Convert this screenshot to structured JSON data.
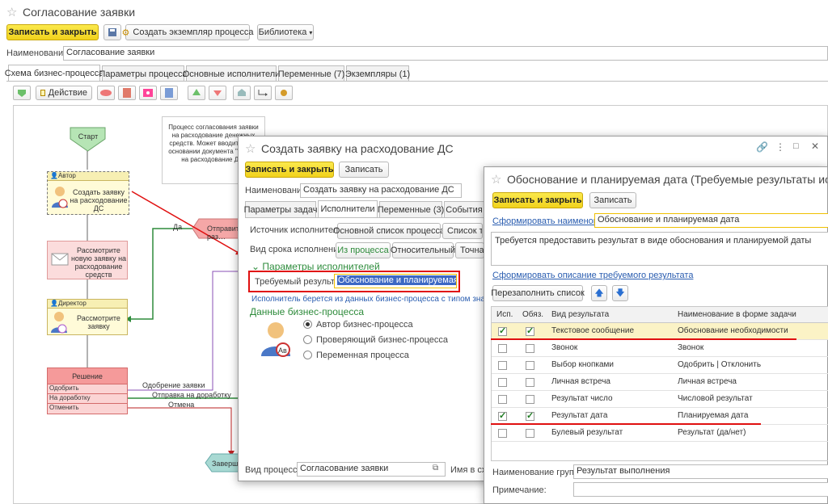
{
  "main": {
    "title": "Согласование заявки",
    "toolbar": {
      "save_close": "Записать и закрыть",
      "create_instance": "Создать экземпляр процесса",
      "library": "Библиотека"
    },
    "name_label": "Наименование:",
    "name_value": "Согласование заявки",
    "tabs": [
      "Схема бизнес-процесса",
      "Параметры процесса",
      "Основные исполнители",
      "Переменные (7)",
      "Экземпляры (1)"
    ],
    "action_label": "Действие"
  },
  "diagram": {
    "start": "Старт",
    "note": "Процесс согласования заявки на расходование денежных средств. Может вводиться на основании документа \"Заявка на расходование ДС\"",
    "author_head": "Автор",
    "author_task": "Создать заявку на расходование ДС",
    "review_task": "Рассмотрите новую заявку на расходование средств",
    "director_head": "Директор",
    "director_task": "Рассмотрите заявку",
    "decision_head": "Решение",
    "decision_items": [
      "Одобрить",
      "На доработку",
      "Отменить"
    ],
    "edge_yes": "Да",
    "edge_approve": "Одобрение заявки",
    "edge_rework": "Отправка на доработку",
    "edge_cancel": "Отмена",
    "send_node": "Отправит… раз…",
    "finish_node": "Заверш…"
  },
  "win2": {
    "title": "Создать заявку на расходование ДС",
    "btn_save_close": "Записать и закрыть",
    "btn_save": "Записать",
    "name_label": "Наименование:",
    "name_value": "Создать заявку на расходование ДС",
    "tabs": [
      "Параметры задач",
      "Исполнители",
      "Переменные (3)",
      "События"
    ],
    "exec_source_label": "Источник исполнителей:",
    "exec_source_opts": [
      "Основной список процесса",
      "Список текс…"
    ],
    "deadline_label": "Вид срока исполнения:",
    "deadline_opts": [
      "Из процесса",
      "Относительный",
      "Точная…"
    ],
    "params_header": "Параметры исполнителей",
    "required_result_label": "Требуемый результат:",
    "required_result_value": "Обоснование и планируемая дата",
    "info_text": "Исполнитель берется из данных бизнес-процесса с типом значения…",
    "bp_data_header": "Данные бизнес-процесса",
    "radio_opts": [
      "Автор бизнес-процесса",
      "Проверяющий бизнес-процесса",
      "Переменная процесса"
    ],
    "process_type_label": "Вид процесса:",
    "process_type_value": "Согласование заявки",
    "name_in_label": "Имя в схе…"
  },
  "win3": {
    "title": "Обоснование и планируемая дата (Требуемые результаты испо…",
    "btn_save_close": "Записать и закрыть",
    "btn_save": "Записать",
    "form_name_link": "Сформировать наименование",
    "form_name_value": "Обоснование и планируемая дата",
    "description": "Требуется предоставить результат в виде обоснования и планируемой даты",
    "form_desc_link": "Сформировать описание требуемого результата",
    "refill_btn": "Перезаполнить список",
    "columns": [
      "Исп.",
      "Обяз.",
      "Вид результата",
      "Наименование в форме задачи"
    ],
    "rows": [
      {
        "use": true,
        "req": true,
        "kind": "Текстовое сообщение",
        "name": "Обоснование необходимости"
      },
      {
        "use": false,
        "req": false,
        "kind": "Звонок",
        "name": "Звонок"
      },
      {
        "use": false,
        "req": false,
        "kind": "Выбор кнопками",
        "name": "Одобрить | Отклонить"
      },
      {
        "use": false,
        "req": false,
        "kind": "Личная встреча",
        "name": "Личная встреча"
      },
      {
        "use": false,
        "req": false,
        "kind": "Результат число",
        "name": "Числовой результат"
      },
      {
        "use": true,
        "req": true,
        "kind": "Результат дата",
        "name": "Планируемая дата"
      },
      {
        "use": false,
        "req": false,
        "kind": "Булевый результат",
        "name": "Результат (да/нет)"
      }
    ],
    "group_label": "Наименование группы:",
    "group_value": "Результат выполнения",
    "note_label": "Примечание:"
  },
  "colors": {
    "accent_yellow": "#f5d825",
    "highlight_red": "#e01010",
    "link_blue": "#2a5db0",
    "green": "#2e8b3b"
  }
}
